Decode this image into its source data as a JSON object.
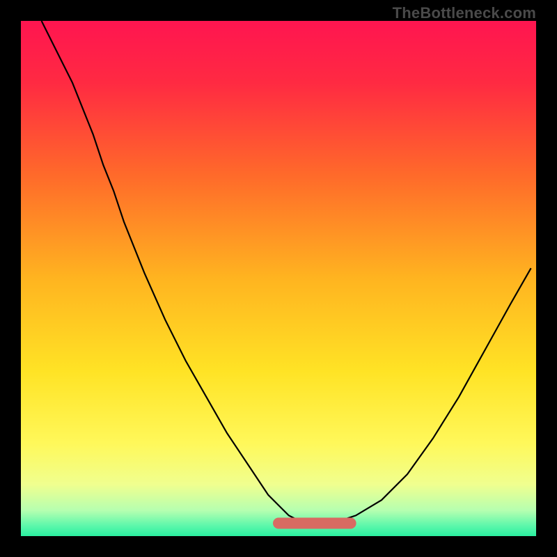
{
  "watermark": "TheBottleneck.com",
  "colors": {
    "background": "#000000",
    "gradient_stops": [
      {
        "offset": 0.0,
        "color": "#ff1550"
      },
      {
        "offset": 0.12,
        "color": "#ff2a42"
      },
      {
        "offset": 0.3,
        "color": "#ff6a2a"
      },
      {
        "offset": 0.5,
        "color": "#ffb420"
      },
      {
        "offset": 0.68,
        "color": "#ffe325"
      },
      {
        "offset": 0.82,
        "color": "#fff85a"
      },
      {
        "offset": 0.9,
        "color": "#f0ff8f"
      },
      {
        "offset": 0.95,
        "color": "#b6ffb0"
      },
      {
        "offset": 0.98,
        "color": "#5cf7ab"
      },
      {
        "offset": 1.0,
        "color": "#2af0a0"
      }
    ],
    "curve": "#000000",
    "accent_band": "#d86b62",
    "watermark": "#4a4a4a"
  },
  "chart_data": {
    "type": "line",
    "title": "",
    "xlabel": "",
    "ylabel": "",
    "xlim": [
      0,
      100
    ],
    "ylim": [
      0,
      100
    ],
    "series": [
      {
        "name": "bottleneck-curve",
        "x": [
          4,
          6,
          8,
          10,
          12,
          14,
          16,
          18,
          20,
          24,
          28,
          32,
          36,
          40,
          44,
          48,
          50,
          52,
          54,
          56,
          58,
          60,
          62,
          65,
          70,
          75,
          80,
          85,
          90,
          95,
          99
        ],
        "y": [
          100,
          96,
          92,
          88,
          83,
          78,
          72,
          67,
          61,
          51,
          42,
          34,
          27,
          20,
          14,
          8,
          6,
          4,
          3,
          2.5,
          2.5,
          2.5,
          3,
          4,
          7,
          12,
          19,
          27,
          36,
          45,
          52
        ]
      }
    ],
    "flat_band": {
      "x_start": 50,
      "x_end": 64,
      "y": 2.5
    }
  }
}
